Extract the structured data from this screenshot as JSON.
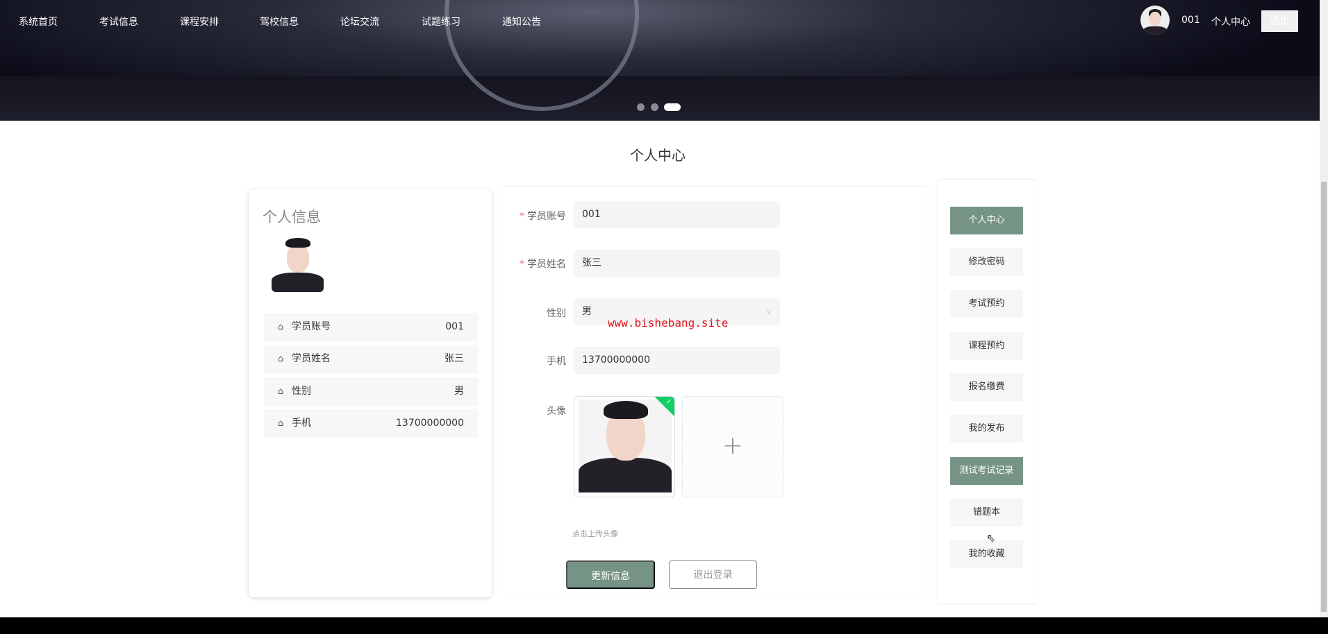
{
  "nav": {
    "items": [
      "系统首页",
      "考试信息",
      "课程安排",
      "驾校信息",
      "论坛交流",
      "试题练习",
      "通知公告"
    ],
    "username": "001",
    "profile_link": "个人中心",
    "logout": "退出"
  },
  "carousel": {
    "slides": 3,
    "active_index": 2
  },
  "page_title": "个人中心",
  "profile_card": {
    "title": "个人信息",
    "rows": [
      {
        "label": "学员账号",
        "value": "001"
      },
      {
        "label": "学员姓名",
        "value": "张三"
      },
      {
        "label": "性别",
        "value": "男"
      },
      {
        "label": "手机",
        "value": "13700000000"
      }
    ]
  },
  "form": {
    "fields": [
      {
        "label": "学员账号",
        "value": "001",
        "required": true
      },
      {
        "label": "学员姓名",
        "value": "张三",
        "required": true
      },
      {
        "label": "性别",
        "value": "男",
        "required": false
      },
      {
        "label": "手机",
        "value": "13700000000",
        "required": false
      }
    ],
    "required_mark": "*",
    "avatar_label": "头像",
    "upload_hint": "点击上传头像",
    "update_button": "更新信息",
    "logout_button": "退出登录",
    "add_icon": "+"
  },
  "watermark": "www.bishebang.site",
  "sidebar": {
    "items": [
      {
        "label": "个人中心",
        "active": true
      },
      {
        "label": "修改密码",
        "active": false
      },
      {
        "label": "考试预约",
        "active": false
      },
      {
        "label": "课程预约",
        "active": false
      },
      {
        "label": "报名缴费",
        "active": false
      },
      {
        "label": "我的发布",
        "active": false
      },
      {
        "label": "测试考试记录",
        "active": true
      },
      {
        "label": "错题本",
        "active": false
      },
      {
        "label": "我的收藏",
        "active": false
      }
    ]
  },
  "colors": {
    "accent": "#769486",
    "success": "#13ce66",
    "watermark": "#e0101a"
  }
}
